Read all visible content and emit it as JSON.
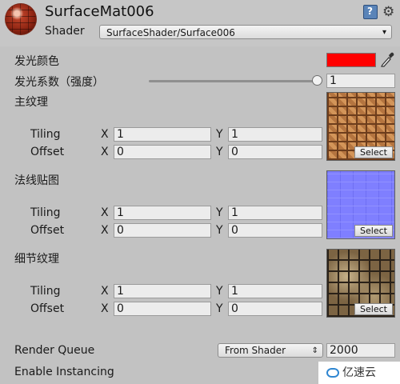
{
  "material": {
    "name": "SurfaceMat006",
    "shader_label": "Shader",
    "shader_value": "SurfaceShader/Surface006"
  },
  "header_icons": {
    "help": "help-book-icon",
    "settings": "gear-icon"
  },
  "properties": {
    "emission_color": {
      "label": "发光颜色",
      "color": "#ff0000"
    },
    "emission_strength": {
      "label": "发光系数（强度）",
      "value": "1",
      "slider_fraction": 1.0
    },
    "textures": [
      {
        "label": "主纹理",
        "select_label": "Select",
        "tiling": {
          "label": "Tiling",
          "x_label": "X",
          "x": "1",
          "y_label": "Y",
          "y": "1"
        },
        "offset": {
          "label": "Offset",
          "x_label": "X",
          "x": "0",
          "y_label": "Y",
          "y": "0"
        }
      },
      {
        "label": "法线贴图",
        "select_label": "Select",
        "tiling": {
          "label": "Tiling",
          "x_label": "X",
          "x": "1",
          "y_label": "Y",
          "y": "1"
        },
        "offset": {
          "label": "Offset",
          "x_label": "X",
          "x": "0",
          "y_label": "Y",
          "y": "0"
        }
      },
      {
        "label": "细节纹理",
        "select_label": "Select",
        "tiling": {
          "label": "Tiling",
          "x_label": "X",
          "x": "1",
          "y_label": "Y",
          "y": "1"
        },
        "offset": {
          "label": "Offset",
          "x_label": "X",
          "x": "0",
          "y_label": "Y",
          "y": "0"
        }
      }
    ]
  },
  "render_queue": {
    "label": "Render Queue",
    "selected": "From Shader",
    "value": "2000"
  },
  "enable_instancing": {
    "label": "Enable Instancing"
  },
  "watermark": {
    "text": "亿速云"
  }
}
